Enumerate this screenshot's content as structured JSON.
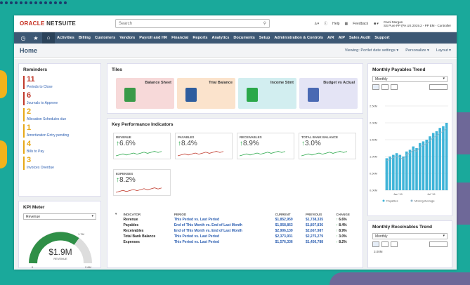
{
  "topbar": {
    "brand": "ORACLE",
    "brand2": "NETSUITE",
    "search_placeholder": "Search",
    "help": "Help",
    "feedback": "Feedback",
    "user_name": "Carol Morgan",
    "user_role": "SS Pure PP (PA US 2019.2 - PP EM - Controller"
  },
  "nav": {
    "items": [
      "Activities",
      "Billing",
      "Customers",
      "Vendors",
      "Payroll and HR",
      "Financial",
      "Reports",
      "Analytics",
      "Documents",
      "Setup",
      "Administration & Controls",
      "A/R",
      "A/P",
      "Sales Audit",
      "Support"
    ]
  },
  "home": {
    "title": "Home",
    "view": "Viewing: Portlet date settings",
    "personalize": "Personalize",
    "layout": "Layout"
  },
  "reminders": {
    "title": "Reminders",
    "items": [
      {
        "count": "11",
        "label": "Periods to Close",
        "color": "#c0392b"
      },
      {
        "count": "6",
        "label": "Journals to Approve",
        "color": "#c0392b"
      },
      {
        "count": "2",
        "label": "Allocation Schedules due",
        "color": "#e6a817"
      },
      {
        "count": "1",
        "label": "Amortization Entry pending",
        "color": "#e6a817"
      },
      {
        "count": "4",
        "label": "Bills to Pay",
        "color": "#e6a817"
      },
      {
        "count": "3",
        "label": "Invoices Overdue",
        "color": "#e6a817"
      }
    ]
  },
  "kpimeter": {
    "title": "KPI Meter",
    "select": "Revenue",
    "value": "$1.9M",
    "label": "REVENUE",
    "min": "0",
    "mid": "1.7M",
    "max": "2.6M"
  },
  "tiles": {
    "title": "Tiles",
    "items": [
      "Balance Sheet",
      "Trial Balance",
      "Income Stmt",
      "Budget vs Actual"
    ]
  },
  "kpis": {
    "title": "Key Performance Indicators",
    "cards": [
      {
        "name": "REVENUE",
        "value": "6.6%"
      },
      {
        "name": "PAYABLES",
        "value": "8.4%"
      },
      {
        "name": "RECEIVABLES",
        "value": "8.9%"
      },
      {
        "name": "TOTAL BANK BALANCE",
        "value": "3.0%"
      },
      {
        "name": "EXPENSES",
        "value": "8.2%"
      }
    ],
    "headers": [
      "INDICATOR",
      "PERIOD",
      "CURRENT",
      "PREVIOUS",
      "CHANGE"
    ],
    "rows": [
      [
        "Revenue",
        "This Period vs. Last Period",
        "$1,852,959",
        "$1,738,335",
        "6.6%"
      ],
      [
        "Payables",
        "End of This Month vs. End of Last Month",
        "$1,958,863",
        "$1,807,836",
        "8.4%"
      ],
      [
        "Receivables",
        "End of This Month vs. End of Last Month",
        "$2,906,139",
        "$2,667,987",
        "8.9%"
      ],
      [
        "Total Bank Balance",
        "This Period vs. Last Period",
        "$2,373,931",
        "$2,275,279",
        "3.0%"
      ],
      [
        "Expenses",
        "This Period vs. Last Period",
        "$1,576,336",
        "$1,456,788",
        "8.2%"
      ]
    ]
  },
  "payables": {
    "title": "Monthly Payables Trend",
    "select": "Monthly",
    "yticks": [
      "2.50M",
      "2.00M",
      "1.50M",
      "1.00M",
      "0.50M",
      "0.00M"
    ],
    "xticks": [
      "Jan '19",
      "Jul '19"
    ],
    "legend": [
      "Payables",
      "Moving Average"
    ]
  },
  "receivables": {
    "title": "Monthly Receivables Trend",
    "select": "Monthly",
    "ytick": "3.00M"
  },
  "chart_data": {
    "type": "bar",
    "series": [
      {
        "name": "Payables",
        "values": [
          0.95,
          1.0,
          1.05,
          1.1,
          1.05,
          1.0,
          1.15,
          1.2,
          1.3,
          1.25,
          1.4,
          1.45,
          1.5,
          1.6,
          1.7,
          1.75,
          1.85,
          1.9,
          2.0
        ]
      }
    ],
    "ylim": [
      0,
      2.5
    ]
  }
}
